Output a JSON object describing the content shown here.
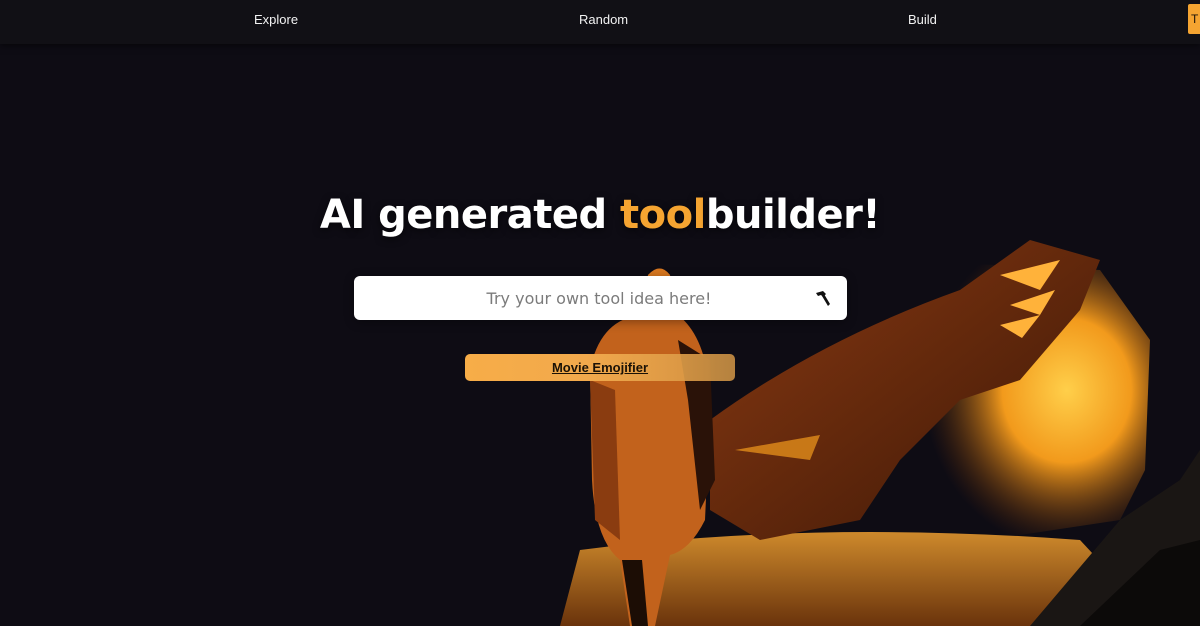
{
  "nav": {
    "items": [
      {
        "label": "Explore"
      },
      {
        "label": "Random"
      },
      {
        "label": "Build"
      }
    ],
    "cta_label": "T"
  },
  "hero": {
    "title_part1": "AI generated ",
    "title_accent": "tool",
    "title_part2": "builder!",
    "accent_color": "#f5a431"
  },
  "search": {
    "placeholder": "Try your own tool idea here!",
    "value": "",
    "icon": "hammer-icon"
  },
  "suggestion": {
    "label": "Movie Emojifier"
  }
}
